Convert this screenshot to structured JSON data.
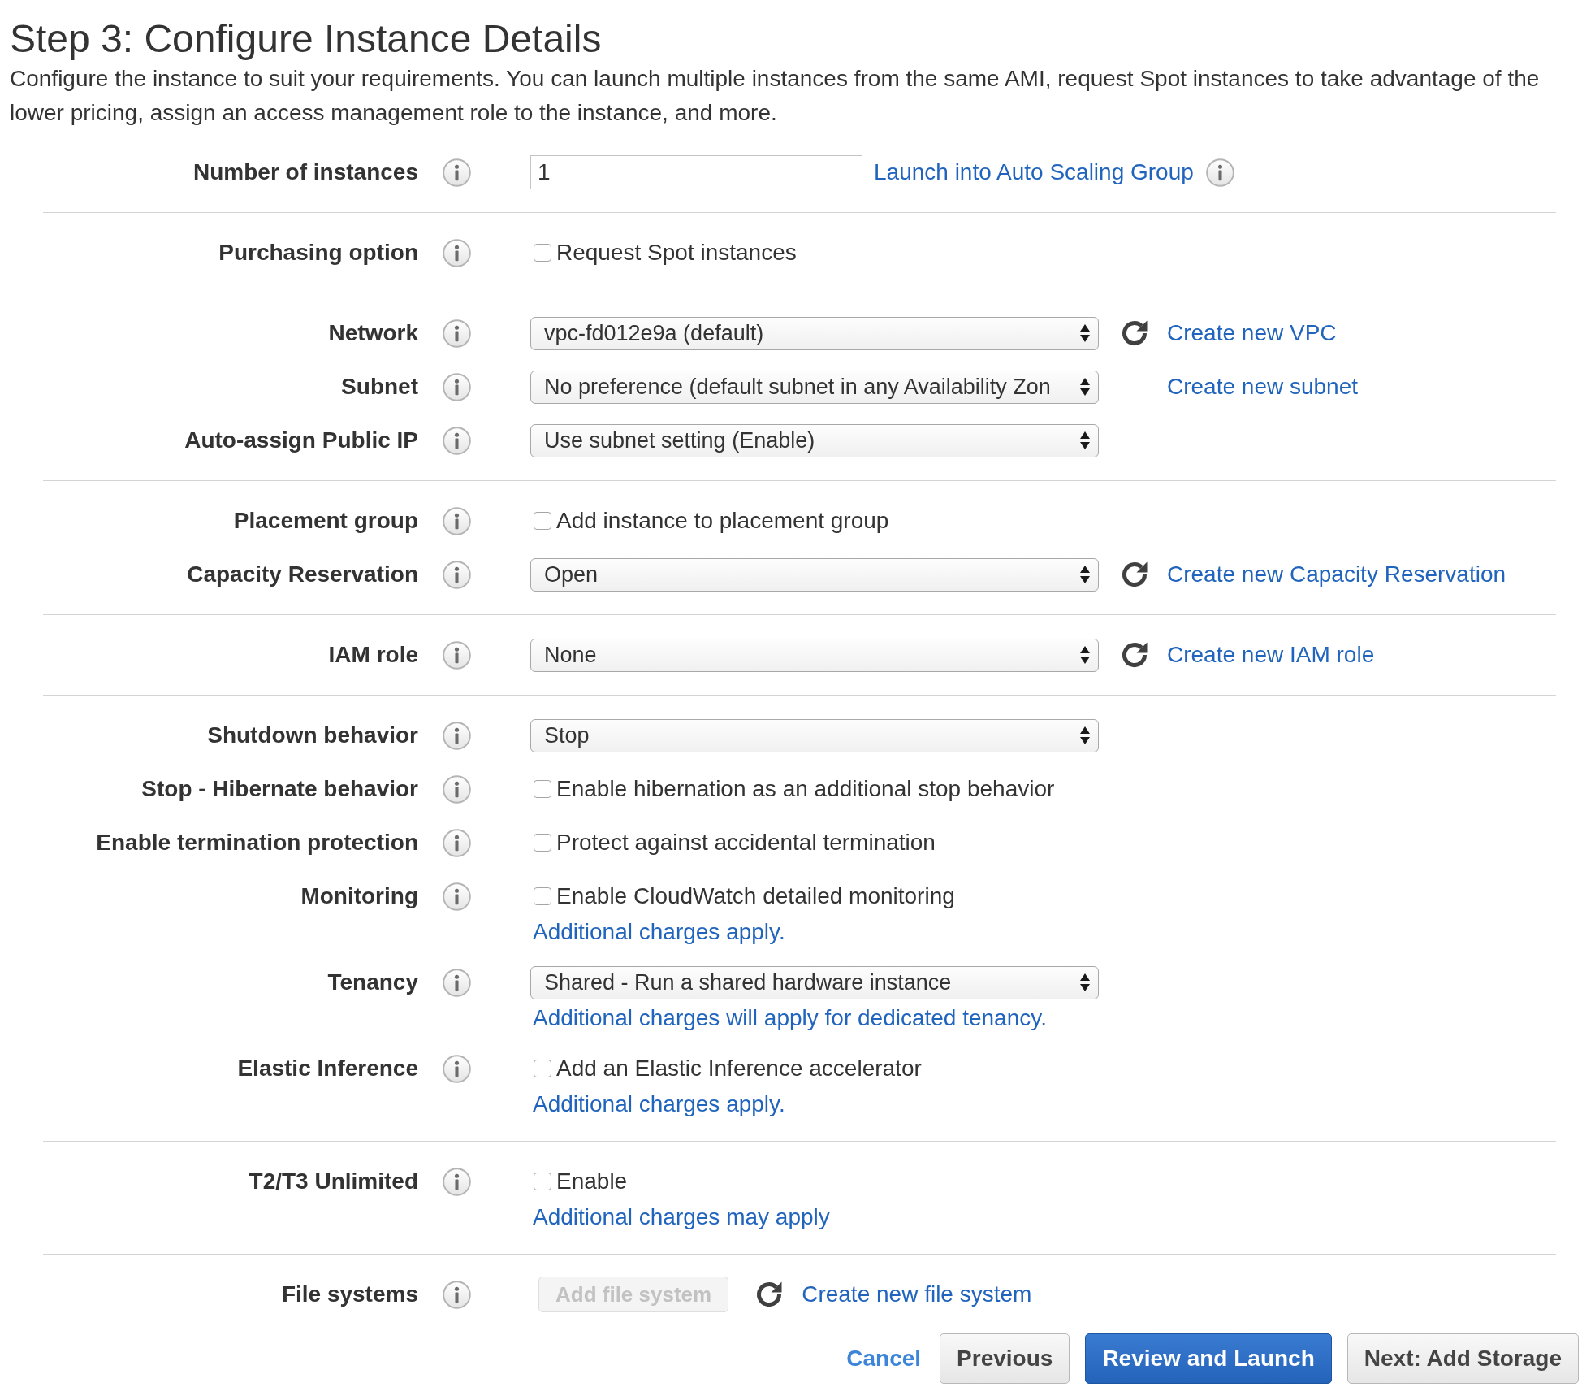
{
  "page": {
    "title": "Step 3: Configure Instance Details",
    "description": "Configure the instance to suit your requirements. You can launch multiple instances from the same AMI, request Spot instances to take advantage of the lower pricing, assign an access management role to the instance, and more."
  },
  "sections": [
    {
      "rows": [
        {
          "label": "Number of instances",
          "control": {
            "kind": "input",
            "value": "1"
          },
          "side": {
            "link": "Launch into Auto Scaling Group",
            "info": true
          }
        }
      ]
    },
    {
      "rows": [
        {
          "label": "Purchasing option",
          "control": {
            "kind": "checkbox",
            "text": "Request Spot instances",
            "checked": false
          }
        }
      ]
    },
    {
      "rows": [
        {
          "label": "Network",
          "control": {
            "kind": "select",
            "value": "vpc-fd012e9a (default)"
          },
          "side": {
            "refresh": true,
            "link": "Create new VPC"
          }
        },
        {
          "label": "Subnet",
          "control": {
            "kind": "select",
            "value": "No preference (default subnet in any Availability Zon"
          },
          "side": {
            "refresh": false,
            "link": "Create new subnet"
          }
        },
        {
          "label": "Auto-assign Public IP",
          "control": {
            "kind": "select",
            "value": "Use subnet setting (Enable)"
          }
        }
      ]
    },
    {
      "rows": [
        {
          "label": "Placement group",
          "control": {
            "kind": "checkbox",
            "text": "Add instance to placement group",
            "checked": false
          }
        },
        {
          "label": "Capacity Reservation",
          "control": {
            "kind": "select",
            "value": "Open"
          },
          "side": {
            "refresh": true,
            "link": "Create new Capacity Reservation"
          }
        }
      ]
    },
    {
      "rows": [
        {
          "label": "IAM role",
          "control": {
            "kind": "select",
            "value": "None"
          },
          "side": {
            "refresh": true,
            "link": "Create new IAM role"
          }
        }
      ]
    },
    {
      "rows": [
        {
          "label": "Shutdown behavior",
          "control": {
            "kind": "select",
            "value": "Stop"
          }
        },
        {
          "label": "Stop - Hibernate behavior",
          "control": {
            "kind": "checkbox",
            "text": "Enable hibernation as an additional stop behavior",
            "checked": false
          }
        },
        {
          "label": "Enable termination protection",
          "control": {
            "kind": "checkbox",
            "text": "Protect against accidental termination",
            "checked": false
          }
        },
        {
          "label": "Monitoring",
          "control": {
            "kind": "checkbox",
            "text": "Enable CloudWatch detailed monitoring",
            "checked": false
          },
          "note": "Additional charges apply."
        },
        {
          "label": "Tenancy",
          "control": {
            "kind": "select",
            "value": "Shared - Run a shared hardware instance"
          },
          "note": "Additional charges will apply for dedicated tenancy."
        },
        {
          "label": "Elastic Inference",
          "control": {
            "kind": "checkbox",
            "text": "Add an Elastic Inference accelerator",
            "checked": false
          },
          "note": "Additional charges apply."
        }
      ]
    },
    {
      "rows": [
        {
          "label": "T2/T3 Unlimited",
          "control": {
            "kind": "checkbox",
            "text": "Enable",
            "checked": false
          },
          "note": "Additional charges may apply"
        }
      ]
    },
    {
      "rows": [
        {
          "label": "File systems",
          "control": {
            "kind": "button",
            "text": "Add file system",
            "disabled": true
          },
          "side": {
            "refresh": true,
            "link": "Create new file system"
          }
        }
      ]
    }
  ],
  "footer": {
    "buttons": [
      {
        "label": "Cancel",
        "kind": "link"
      },
      {
        "label": "Previous",
        "kind": "secondary"
      },
      {
        "label": "Review and Launch",
        "kind": "primary"
      },
      {
        "label": "Next: Add Storage",
        "kind": "secondary"
      }
    ]
  }
}
